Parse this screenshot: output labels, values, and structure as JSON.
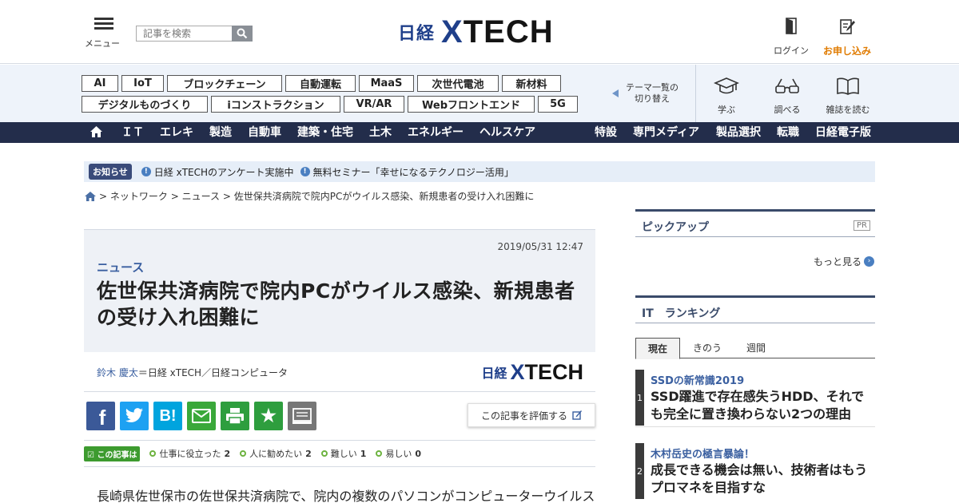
{
  "header": {
    "menu_label": "メニュー",
    "search_placeholder": "記事を検索",
    "logo_nikkei": "日経",
    "logo_x": "X",
    "logo_tech": "TECH",
    "login_label": "ログイン",
    "subscribe_label": "お申し込み",
    "subscribe_color": "#e07b00",
    "brand_color": "#1f3f8a"
  },
  "topics": {
    "tags": [
      "AI",
      "IoT",
      "ブロックチェーン",
      "自動運転",
      "MaaS",
      "次世代電池",
      "新材料",
      "デジタルものづくり",
      "iコンストラクション",
      "VR/AR",
      "Webフロントエンド",
      "5G"
    ],
    "switch_line1": "テーマ一覧の",
    "switch_line2": "切り替え",
    "tools": [
      {
        "label": "学ぶ",
        "icon": "graduation-cap-icon"
      },
      {
        "label": "調べる",
        "icon": "glasses-icon"
      },
      {
        "label": "雑誌を読む",
        "icon": "open-book-icon"
      }
    ]
  },
  "nav": {
    "items": [
      "ＩＴ",
      "エレキ",
      "製造",
      "自動車",
      "建築・住宅",
      "土木",
      "エネルギー",
      "ヘルスケア"
    ],
    "right_items": [
      "特設",
      "専門メディア",
      "製品選択",
      "転職",
      "日経電子版"
    ],
    "bg_color": "#232d4b"
  },
  "notice": {
    "badge": "お知らせ",
    "items": [
      "日経 xTECHのアンケート実施中",
      "無料セミナー「幸せになるテクノロジー活用」"
    ]
  },
  "breadcrumb": {
    "items": [
      "ネットワーク",
      "ニュース",
      "佐世保共済病院で院内PCがウイルス感染、新規患者の受け入れ困難に"
    ],
    "sep": ">"
  },
  "article": {
    "date": "2019/05/31 12:47",
    "category": "ニュース",
    "title": "佐世保共済病院で院内PCがウイルス感染、新規患者の受け入れ困難に",
    "author": "鈴木 慶太",
    "author_affiliation": "＝日経 xTECH／日経コンピュータ",
    "rate_label": "この記事を評価する",
    "eval_badge": "この記事は",
    "eval_items": [
      {
        "label": "仕事に役立った",
        "count": "2"
      },
      {
        "label": "人に勧めたい",
        "count": "2"
      },
      {
        "label": "難しい",
        "count": "1"
      },
      {
        "label": "易しい",
        "count": "0"
      }
    ],
    "body_start": "長崎県佐世保市の佐世保共済病院で、院内の複数のパソコンがコンピューターウイルス"
  },
  "share": {
    "buttons": [
      {
        "name": "facebook",
        "glyph": "f",
        "color": "#3b5998"
      },
      {
        "name": "twitter",
        "glyph": "t",
        "color": "#1da1f2"
      },
      {
        "name": "hatena",
        "glyph": "B!",
        "color": "#00a4de"
      },
      {
        "name": "mail",
        "glyph": "",
        "color": "#3aa83a"
      },
      {
        "name": "print",
        "glyph": "",
        "color": "#2e9e3e"
      },
      {
        "name": "favorite",
        "glyph": "★",
        "color": "#2e9e3e"
      },
      {
        "name": "memo",
        "glyph": "",
        "color": "#777777"
      }
    ]
  },
  "sidebar": {
    "pickup_title": "ピックアップ",
    "pr_label": "PR",
    "more_label": "もっと見る",
    "ranking_title": "IT　ランキング",
    "tabs": [
      "現在",
      "きのう",
      "週間"
    ],
    "ranking": [
      {
        "rank": "1",
        "category": "SSDの新常識2019",
        "title": "SSD躍進で存在感失うHDD、それでも完全に置き換わらない2つの理由"
      },
      {
        "rank": "2",
        "category": "木村岳史の極言暴論！",
        "title": "成長できる機会は無い、技術者はもうプロマネを目指すな"
      }
    ]
  }
}
